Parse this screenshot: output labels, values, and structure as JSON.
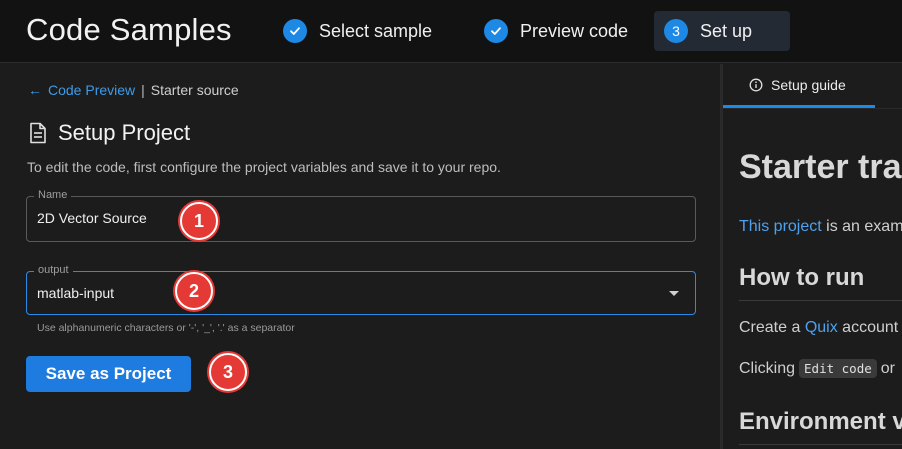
{
  "app": {
    "title": "Code Samples"
  },
  "steps": [
    {
      "label": "Select sample",
      "status": "complete",
      "icon": "check-icon"
    },
    {
      "label": "Preview code",
      "status": "complete",
      "icon": "check-icon"
    },
    {
      "label": "Set up",
      "number": "3",
      "status": "active"
    }
  ],
  "breadcrumb": {
    "back": "Code Preview",
    "separator": "|",
    "current": "Starter source"
  },
  "setup": {
    "title": "Setup Project",
    "description": "To edit the code, first configure the project variables and save it to your repo.",
    "name_field": {
      "label": "Name",
      "value": "2D Vector Source"
    },
    "output_field": {
      "label": "output",
      "value": "matlab-input",
      "helper": "Use alphanumeric characters or '-', '_', '.' as a separator"
    },
    "save_button": "Save as Project"
  },
  "callouts": [
    "1",
    "2",
    "3"
  ],
  "guide": {
    "tab": "Setup guide",
    "heading": "Starter transformation",
    "intro_link": "This project",
    "intro_rest": " is an example",
    "how_to_run": "How to run",
    "create_prefix": "Create a ",
    "create_link": "Quix",
    "create_rest": " account",
    "clicking_prefix": "Clicking",
    "clicking_code": "Edit code",
    "clicking_rest": "or",
    "env_heading": "Environment variables"
  },
  "colors": {
    "accent": "#1e88e5",
    "callout": "#e53935",
    "background": "#1c1c1c",
    "topbar": "#121212"
  }
}
